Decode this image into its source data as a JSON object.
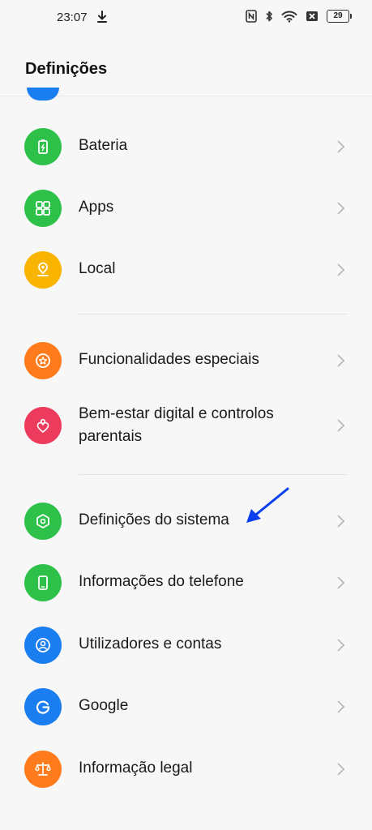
{
  "status": {
    "time": "23:07",
    "battery": "29"
  },
  "header": {
    "title": "Definições"
  },
  "items": [
    {
      "label": "Bateria",
      "color": "#2ec14a",
      "icon": "battery-icon"
    },
    {
      "label": "Apps",
      "color": "#2ec14a",
      "icon": "apps-grid-icon"
    },
    {
      "label": "Local",
      "color": "#f8b400",
      "icon": "location-pin-icon"
    },
    {
      "label": "Funcionalidades especiais",
      "color": "#ff7b1c",
      "icon": "star-circle-icon"
    },
    {
      "label": "Bem-estar digital e controlos",
      "label2": "parentais",
      "color": "#ec3b5c",
      "icon": "heart-person-icon"
    },
    {
      "label": "Definições do sistema",
      "color": "#2ec14a",
      "icon": "hexagon-icon"
    },
    {
      "label": "Informações do telefone",
      "color": "#2ec14a",
      "icon": "phone-icon"
    },
    {
      "label": "Utilizadores e contas",
      "color": "#1a7df0",
      "icon": "user-icon"
    },
    {
      "label": "Google",
      "color": "#1a7df0",
      "icon": "google-g-icon"
    },
    {
      "label": "Informação legal",
      "color": "#ff7b1c",
      "icon": "scales-icon"
    }
  ],
  "colors": {
    "annotation_arrow": "#0a3ff0"
  }
}
